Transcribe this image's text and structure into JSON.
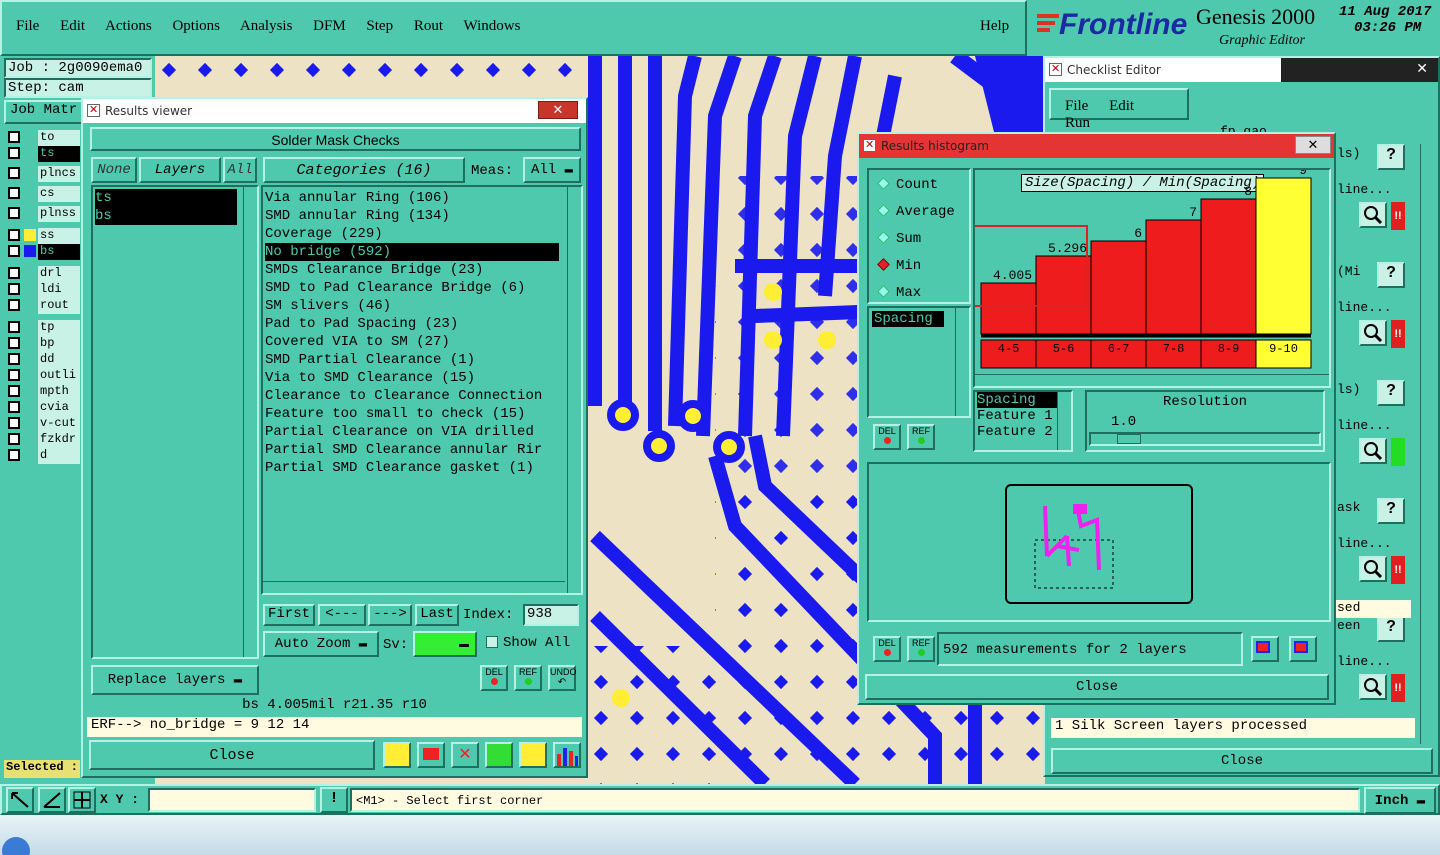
{
  "menu": {
    "items": [
      "File",
      "Edit",
      "Actions",
      "Options",
      "Analysis",
      "DFM",
      "Step",
      "Rout",
      "Windows"
    ],
    "help": "Help"
  },
  "branding": {
    "logo": "Frontline",
    "product": "Genesis 2000",
    "subtitle": "Graphic Editor",
    "date": "11 Aug 2017",
    "time": "03:26 PM"
  },
  "left_panel": {
    "job": "Job : 2g0090ema0",
    "step": "Step: cam",
    "job_matrix": "Job Matr",
    "selected": "Selected :",
    "layers": [
      "to",
      "ts",
      "plncs",
      "cs",
      "plnss",
      "ss",
      "bs",
      "drl",
      "ldi",
      "rout",
      "tp",
      "bp",
      "dd",
      "outli",
      "mpth",
      "cvia",
      "v-cut",
      "fzkdr",
      "d"
    ]
  },
  "results_viewer": {
    "title": "Results viewer",
    "header": "Solder Mask Checks",
    "none": "None",
    "layers_btn": "Layers",
    "all_btn": "All",
    "layer_list": [
      "ts",
      "bs"
    ],
    "categories_btn": "Categories (16)",
    "meas_label": "Meas:",
    "meas_value": "All",
    "categories": [
      "Via annular Ring (106)",
      "SMD annular Ring (134)",
      "Coverage (229)",
      "No bridge (592)",
      "SMDs Clearance Bridge (23)",
      "SMD to Pad Clearance Bridge (6)",
      "SM slivers (46)",
      "Pad to Pad Spacing (23)",
      "Covered VIA to SM (27)",
      "SMD Partial Clearance (1)",
      "Via to SMD Clearance (15)",
      "Clearance to Clearance Connection",
      "Feature too small to check (15)",
      "Partial Clearance on VIA drilled",
      "Partial SMD Clearance annular Rir",
      "Partial SMD Clearance gasket (1)"
    ],
    "selected_category": "No bridge (592)",
    "first": "First",
    "prev": "<---",
    "next": "--->",
    "last": "Last",
    "index_label": "Index:",
    "index_value": "938",
    "auto_zoom": "Auto Zoom",
    "sv_label": "Sv:",
    "show_all": "Show All",
    "replace_layers": "Replace layers",
    "status": "bs 4.005mil  r21.35  r10",
    "erf": "ERF--> no_bridge = 9 12 14",
    "close": "Close",
    "del": "DEL",
    "ref": "REF",
    "undo": "UNDO"
  },
  "histogram": {
    "title": "Results histogram",
    "modes": [
      "Count",
      "Average",
      "Sum",
      "Min",
      "Max"
    ],
    "selected_mode": "Min",
    "list_item": "Spacing",
    "chart_title": "Size(Spacing) / Min(Spacing)",
    "bars": [
      {
        "range": "4-5",
        "value": "4.005",
        "color": "#ee1c1c"
      },
      {
        "range": "5-6",
        "value": "5.296",
        "color": "#ee1c1c"
      },
      {
        "range": "6-7",
        "value": "6",
        "color": "#ee1c1c"
      },
      {
        "range": "7-8",
        "value": "7",
        "color": "#ee1c1c"
      },
      {
        "range": "8-9",
        "value": "8",
        "color": "#ee1c1c"
      },
      {
        "range": "9-10",
        "value": "9",
        "color": "#ffff33"
      }
    ],
    "bar_values": [
      4.005,
      5.296,
      6,
      7,
      8,
      9
    ],
    "field_list": [
      "Spacing",
      "Feature 1",
      "Feature 2"
    ],
    "resolution_label": "Resolution",
    "resolution_value": "1.0",
    "measurements": "592 measurements for 2 layers",
    "close": "Close",
    "del": "DEL",
    "ref": "REF"
  },
  "checklist": {
    "title": "Checklist Editor",
    "menu": [
      "File",
      "Edit",
      "Run"
    ],
    "name_partial": "fp_gao",
    "rows": [
      {
        "label": "ls)",
        "status": "line...",
        "flag": "!!",
        "color": "#e02020"
      },
      {
        "label": "(Mi",
        "status": "line...",
        "flag": "!!",
        "color": "#e02020"
      },
      {
        "label": "ls)",
        "status": "line...",
        "flag": "",
        "color": "#22dd22"
      },
      {
        "label": "ask",
        "status": "line...",
        "flag": "!!",
        "color": "#e02020"
      },
      {
        "label": "een",
        "status": "line...",
        "flag": "!!",
        "color": "#e02020"
      }
    ],
    "sed": "sed",
    "processed": "1 Silk Screen layers processed",
    "close": "Close"
  },
  "statusbar": {
    "xy_label": "X Y :",
    "message": "<M1> - Select first corner",
    "units": "Inch"
  },
  "colors": {
    "teal": "#4ec9ae",
    "blue_trace": "#1a1aee",
    "board": "#ede3c4",
    "pad": "#ffee33"
  }
}
